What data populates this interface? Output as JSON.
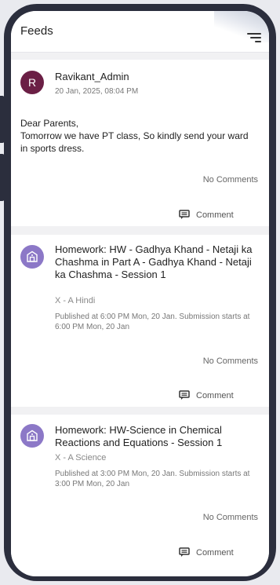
{
  "header": {
    "title": "Feeds"
  },
  "posts": [
    {
      "author": "Ravikant_Admin",
      "avatar_letter": "R",
      "date": "20 Jan, 2025, 08:04 PM",
      "message_line1": "Dear Parents,",
      "message_line2": "Tomorrow we have PT class, So kindly send your ward in sports dress.",
      "comments_status": "No Comments",
      "comment_label": "Comment"
    },
    {
      "title": "Homework: HW -  Gadhya Khand - Netaji ka Chashma in Part A - Gadhya Khand - Netaji ka Chashma - Session 1",
      "class_subject": "X - A Hindi",
      "published": "Published at 6:00 PM Mon, 20 Jan. Submission starts at 6:00 PM Mon, 20 Jan",
      "comments_status": "No Comments",
      "comment_label": "Comment"
    },
    {
      "title": "Homework: HW-Science in Chemical Reactions and Equations - Session 1",
      "class_subject": "X - A Science",
      "published": "Published at 3:00 PM Mon, 20 Jan. Submission starts at 3:00 PM Mon, 20 Jan",
      "comments_status": "No Comments",
      "comment_label": "Comment"
    }
  ],
  "icons": {
    "filter": "filter-lines-icon",
    "comment": "comment-bubble-icon",
    "homework": "school-icon"
  },
  "colors": {
    "admin_avatar": "#6b1f45",
    "homework_avatar": "#8c78c7",
    "phone_frame": "#2b2e3d"
  }
}
